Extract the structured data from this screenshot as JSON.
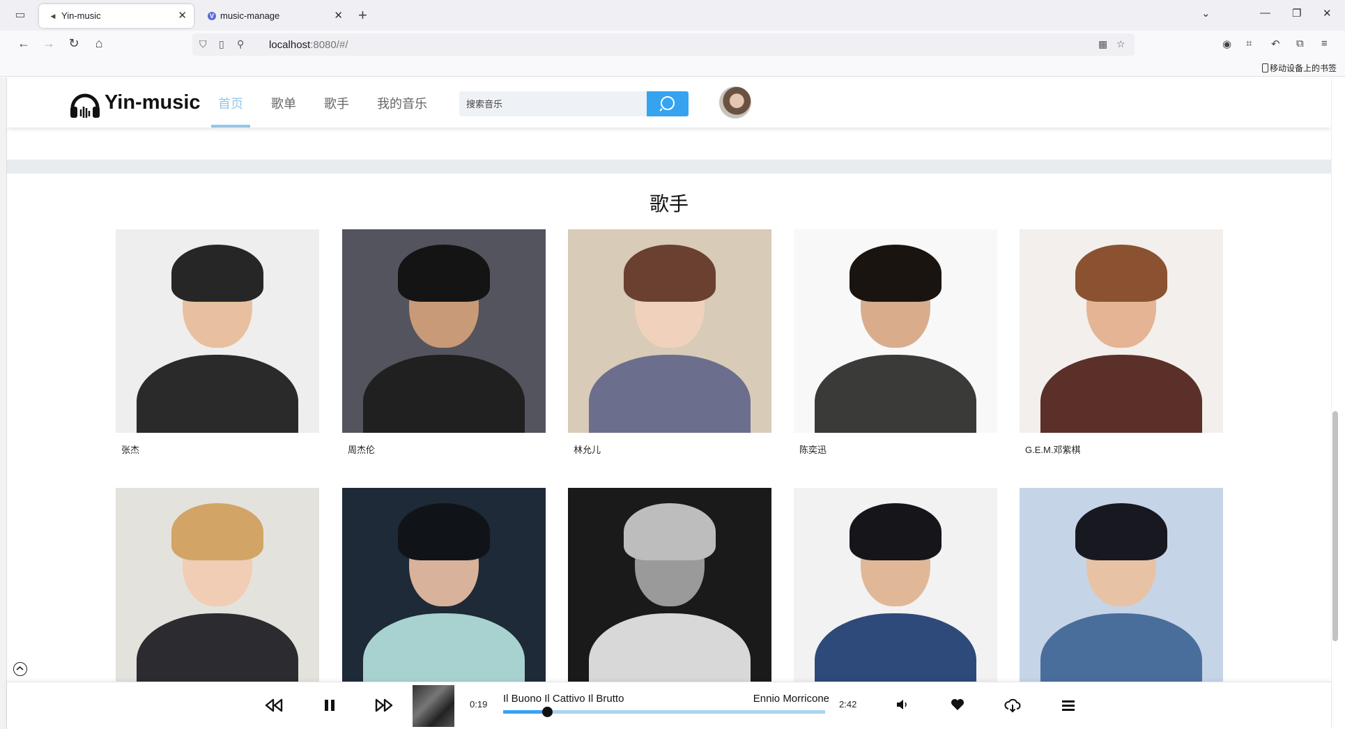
{
  "browser": {
    "tabs": [
      {
        "title": "Yin-music",
        "active": true
      },
      {
        "title": "music-manage",
        "active": false
      }
    ],
    "url_host": "localhost",
    "url_rest": ":8080/#/",
    "mobile_bookmarks": "移动设备上的书签"
  },
  "header": {
    "logo_text": "Yin-music",
    "menu": [
      {
        "label": "首页",
        "active": true
      },
      {
        "label": "歌单",
        "active": false
      },
      {
        "label": "歌手",
        "active": false
      },
      {
        "label": "我的音乐",
        "active": false
      }
    ],
    "search_placeholder": "搜索音乐"
  },
  "section": {
    "title": "歌手",
    "singers": [
      {
        "name": "张杰"
      },
      {
        "name": "周杰伦"
      },
      {
        "name": "林允儿"
      },
      {
        "name": "陈奕迅"
      },
      {
        "name": "G.E.M.邓紫棋"
      },
      {
        "name": ""
      },
      {
        "name": ""
      },
      {
        "name": ""
      },
      {
        "name": ""
      },
      {
        "name": ""
      }
    ]
  },
  "player": {
    "current_time": "0:19",
    "duration": "2:42",
    "title": "Il Buono Il Cattivo Il Brutto",
    "artist": "Ennio Morricone",
    "progress": 0.137
  },
  "colors": {
    "accent": "#36a3f0",
    "menu_active": "#95c7e8",
    "band": "#e7ecef"
  }
}
